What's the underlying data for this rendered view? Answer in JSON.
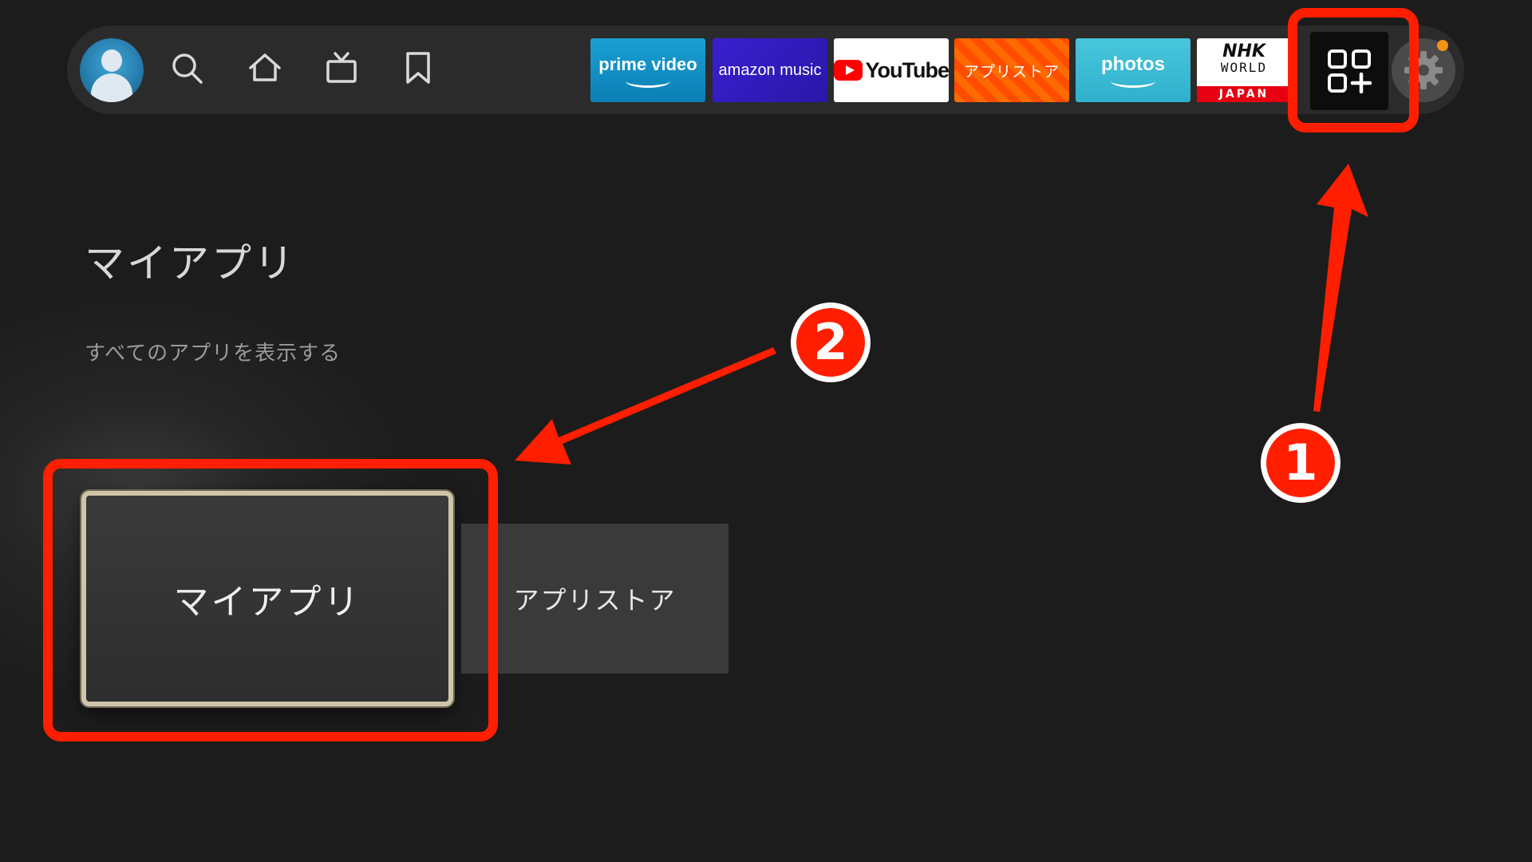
{
  "navbar": {
    "icons": [
      "avatar",
      "search-icon",
      "home-icon",
      "live-tv-icon",
      "bookmark-icon",
      "apps-plus-icon",
      "gear-icon"
    ],
    "apps": {
      "prime_video": "prime video",
      "amazon_music": "amazon music",
      "youtube": "YouTube",
      "appstore": "アプリストア",
      "photos": "photos",
      "nhk": {
        "line1": "NHK",
        "line2": "WORLD",
        "line3": "JAPAN"
      }
    },
    "notification_color": "#f39217"
  },
  "main": {
    "title": "マイアプリ",
    "show_all_link": "すべてのアプリを表示する",
    "cards": {
      "my_apps": "マイアプリ",
      "appstore": "アプリストア"
    }
  },
  "annotations": {
    "badge_1": "1",
    "badge_2": "2",
    "color": "#ff1f00"
  }
}
